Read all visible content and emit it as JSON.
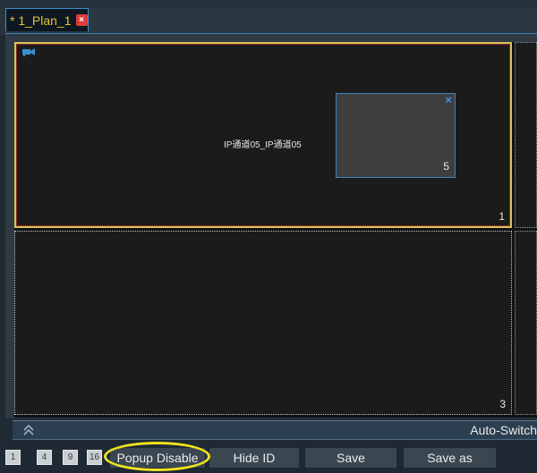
{
  "tab": {
    "label": "* 1_Plan_1",
    "close_glyph": "×"
  },
  "view": {
    "cells": [
      {
        "number": "1",
        "channel_label": "IP通道05_IP通道05"
      },
      {
        "number": "3"
      }
    ],
    "popup": {
      "number": "5",
      "close_glyph": "×"
    }
  },
  "toolbar": {
    "auto_switch_label": "Auto-Switch",
    "split_buttons": [
      "1",
      "4",
      "9",
      "16"
    ],
    "popup_button": "Popup Disable",
    "hide_id_button": "Hide ID",
    "save_button": "Save",
    "save_as_button": "Save as"
  },
  "colors": {
    "tab_text": "#e6c232",
    "tab_close": "#e23b3b",
    "selected_border": "#d8c25c",
    "accent_blue": "#3b8fd1",
    "annotation_ring": "#f0e21e"
  },
  "icons": {
    "camera": "camera-icon",
    "collapse": "double-chevron-up-icon"
  }
}
